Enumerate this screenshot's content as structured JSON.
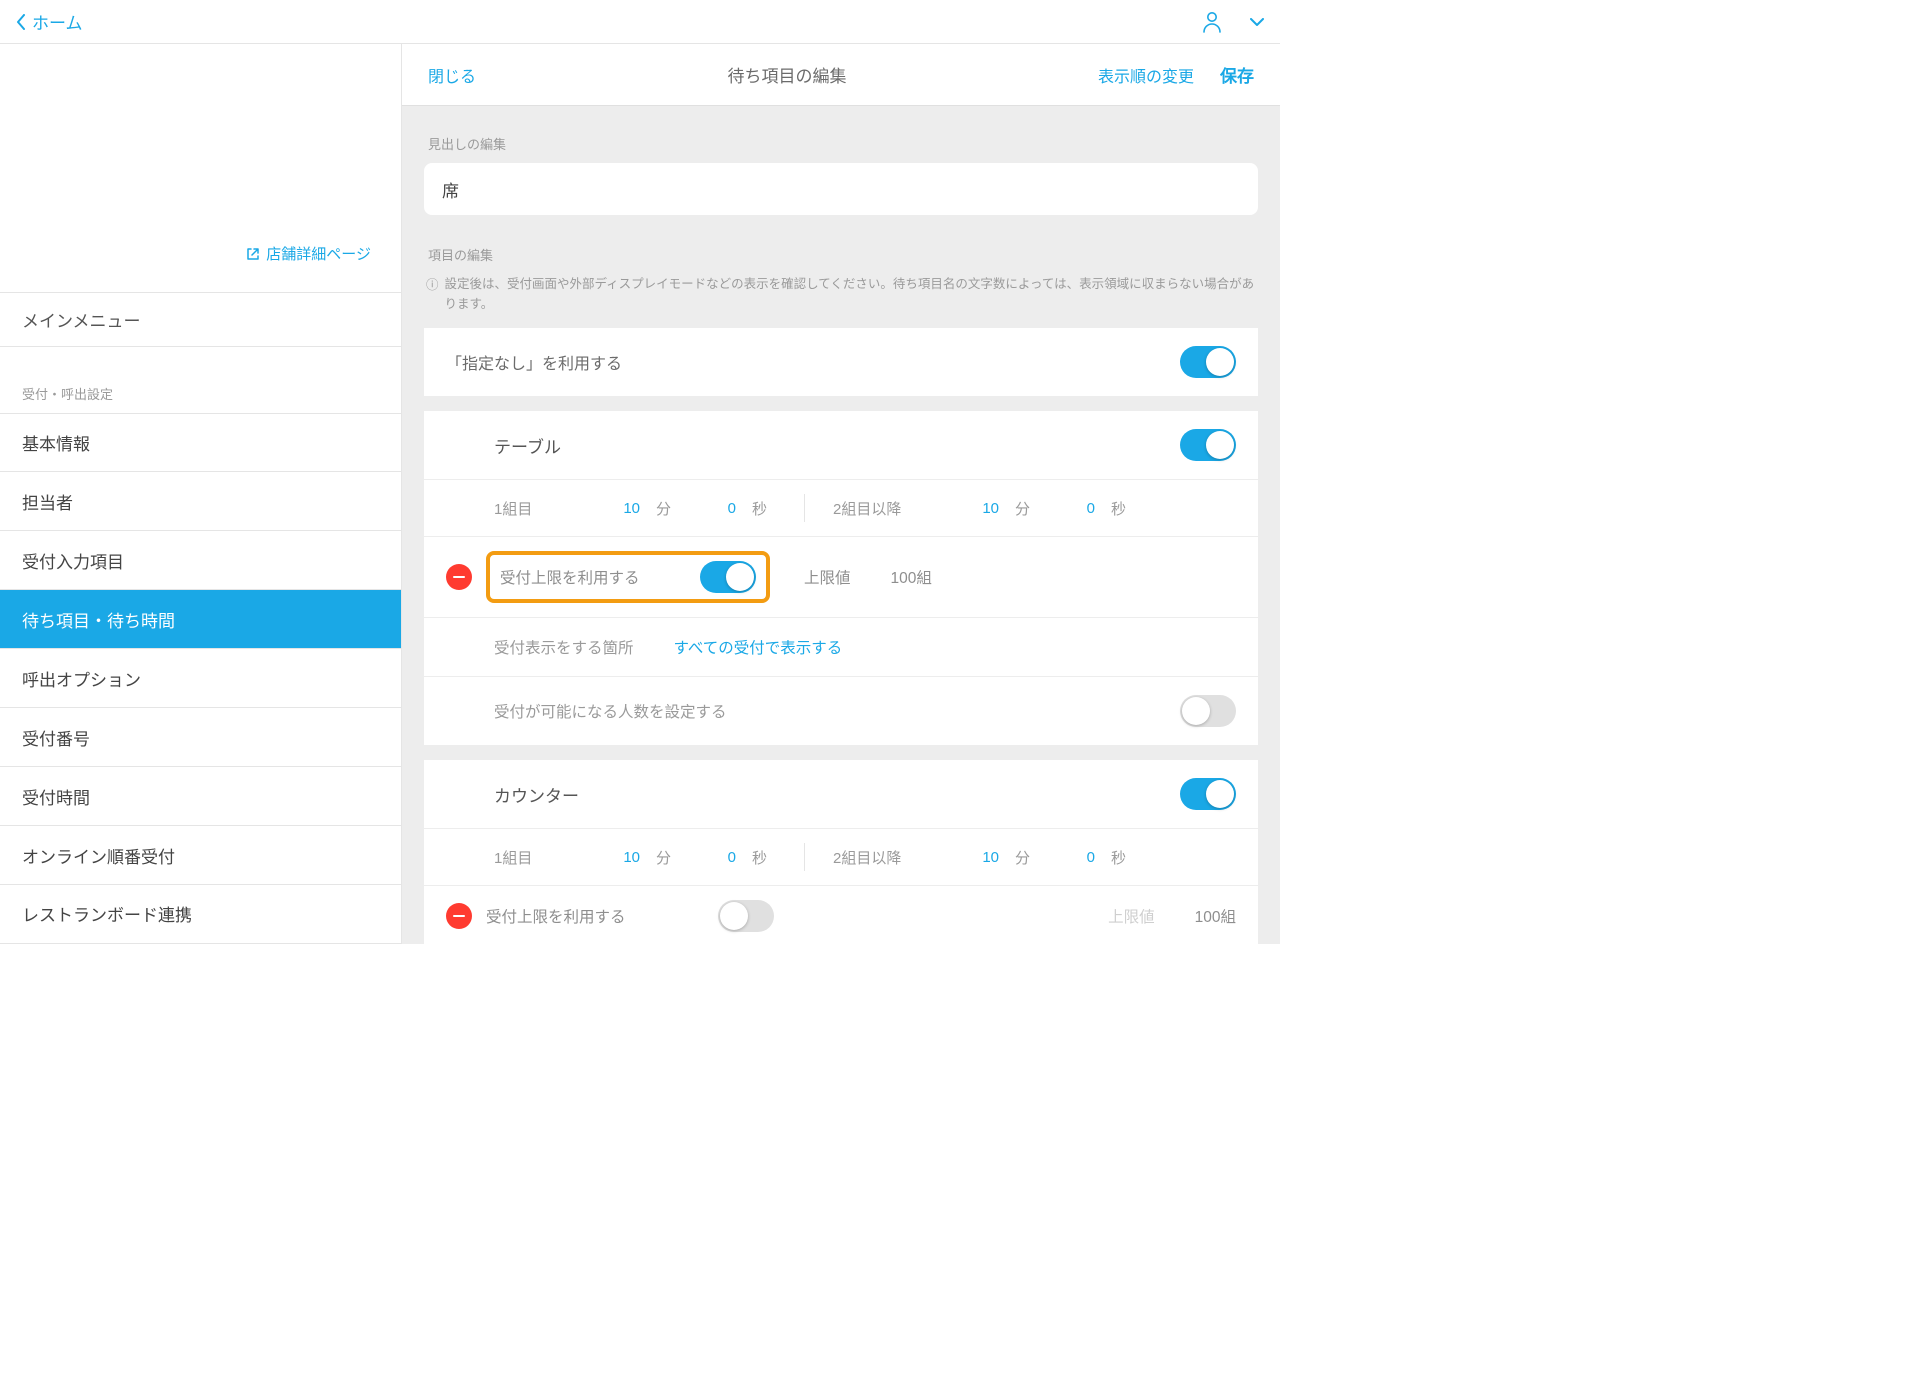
{
  "topbar": {
    "home": "ホーム"
  },
  "sidebar": {
    "shop_link": "店舗詳細ページ",
    "main_menu": "メインメニュー",
    "section_caption": "受付・呼出設定",
    "items": [
      "基本情報",
      "担当者",
      "受付入力項目",
      "待ち項目・待ち時間",
      "呼出オプション",
      "受付番号",
      "受付時間",
      "オンライン順番受付",
      "レストランボード連携"
    ]
  },
  "panel": {
    "close": "閉じる",
    "title": "待ち項目の編集",
    "reorder": "表示順の変更",
    "save": "保存"
  },
  "heading": {
    "label": "見出しの編集",
    "value": "席"
  },
  "items_section": {
    "label": "項目の編集",
    "info": "設定後は、受付画面や外部ディスプレイモードなどの表示を確認してください。待ち項目名の文字数によっては、表示領域に収まらない場合があります。",
    "use_none_label": "「指定なし」を利用する"
  },
  "time_labels": {
    "first": "1組目",
    "after": "2組目以降",
    "min": "分",
    "sec": "秒"
  },
  "limit": {
    "use_label": "受付上限を利用する",
    "cap_label": "上限値",
    "display_label": "受付表示をする箇所",
    "display_value": "すべての受付で表示する",
    "capacity_label": "受付が可能になる人数を設定する",
    "unit_suffix": "組"
  },
  "categories": [
    {
      "name": "テーブル",
      "enabled": true,
      "first_min": 10,
      "first_sec": 0,
      "after_min": 10,
      "after_sec": 0,
      "limit_enabled": true,
      "limit_value": 100,
      "highlighted": true,
      "capacity_enabled": false
    },
    {
      "name": "カウンター",
      "enabled": true,
      "first_min": 10,
      "first_sec": 0,
      "after_min": 10,
      "after_sec": 0,
      "limit_enabled": false,
      "limit_value": 100,
      "highlighted": false
    }
  ]
}
